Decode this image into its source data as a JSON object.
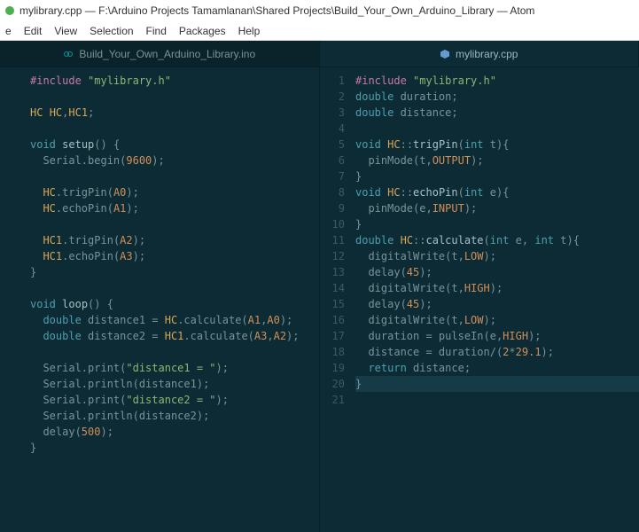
{
  "window": {
    "title": "mylibrary.cpp — F:\\Arduino Projects Tamamlanan\\Shared Projects\\Build_Your_Own_Arduino_Library — Atom"
  },
  "menu": {
    "items": [
      "e",
      "Edit",
      "View",
      "Selection",
      "Find",
      "Packages",
      "Help"
    ]
  },
  "tabs": {
    "left": {
      "label": "Build_Your_Own_Arduino_Library.ino",
      "icon": "arduino-icon",
      "active": false
    },
    "right": {
      "label": "mylibrary.cpp",
      "icon": "cpp-icon",
      "active": true
    }
  },
  "left_pane": {
    "lines": [
      {
        "tokens": [
          [
            "pre",
            "#include"
          ],
          [
            "punc",
            " "
          ],
          [
            "str",
            "\"mylibrary.h\""
          ]
        ]
      },
      {
        "tokens": []
      },
      {
        "tokens": [
          [
            "cls",
            "HC"
          ],
          [
            "punc",
            " "
          ],
          [
            "cls",
            "HC"
          ],
          [
            "punc",
            ","
          ],
          [
            "cls",
            "HC1"
          ],
          [
            "punc",
            ";"
          ]
        ]
      },
      {
        "tokens": []
      },
      {
        "tokens": [
          [
            "type",
            "void"
          ],
          [
            "punc",
            " "
          ],
          [
            "fn",
            "setup"
          ],
          [
            "punc",
            "() {"
          ]
        ]
      },
      {
        "tokens": [
          [
            "punc",
            "  Serial.begin("
          ],
          [
            "num",
            "9600"
          ],
          [
            "punc",
            ");"
          ]
        ]
      },
      {
        "tokens": []
      },
      {
        "tokens": [
          [
            "punc",
            "  "
          ],
          [
            "cls",
            "HC"
          ],
          [
            "punc",
            ".trigPin("
          ],
          [
            "const",
            "A0"
          ],
          [
            "punc",
            ");"
          ]
        ]
      },
      {
        "tokens": [
          [
            "punc",
            "  "
          ],
          [
            "cls",
            "HC"
          ],
          [
            "punc",
            ".echoPin("
          ],
          [
            "const",
            "A1"
          ],
          [
            "punc",
            ");"
          ]
        ]
      },
      {
        "tokens": []
      },
      {
        "tokens": [
          [
            "punc",
            "  "
          ],
          [
            "cls",
            "HC1"
          ],
          [
            "punc",
            ".trigPin("
          ],
          [
            "const",
            "A2"
          ],
          [
            "punc",
            ");"
          ]
        ]
      },
      {
        "tokens": [
          [
            "punc",
            "  "
          ],
          [
            "cls",
            "HC1"
          ],
          [
            "punc",
            ".echoPin("
          ],
          [
            "const",
            "A3"
          ],
          [
            "punc",
            ");"
          ]
        ]
      },
      {
        "tokens": [
          [
            "punc",
            "}"
          ]
        ]
      },
      {
        "tokens": []
      },
      {
        "tokens": [
          [
            "type",
            "void"
          ],
          [
            "punc",
            " "
          ],
          [
            "fn",
            "loop"
          ],
          [
            "punc",
            "() {"
          ]
        ]
      },
      {
        "tokens": [
          [
            "punc",
            "  "
          ],
          [
            "type",
            "double"
          ],
          [
            "punc",
            " distance1 = "
          ],
          [
            "cls",
            "HC"
          ],
          [
            "punc",
            ".calculate("
          ],
          [
            "const",
            "A1"
          ],
          [
            "punc",
            ","
          ],
          [
            "const",
            "A0"
          ],
          [
            "punc",
            ");"
          ]
        ]
      },
      {
        "tokens": [
          [
            "punc",
            "  "
          ],
          [
            "type",
            "double"
          ],
          [
            "punc",
            " distance2 = "
          ],
          [
            "cls",
            "HC1"
          ],
          [
            "punc",
            ".calculate("
          ],
          [
            "const",
            "A3"
          ],
          [
            "punc",
            ","
          ],
          [
            "const",
            "A2"
          ],
          [
            "punc",
            ");"
          ]
        ]
      },
      {
        "tokens": []
      },
      {
        "tokens": [
          [
            "punc",
            "  Serial.print("
          ],
          [
            "str",
            "\"distance1 = \""
          ],
          [
            "punc",
            ");"
          ]
        ]
      },
      {
        "tokens": [
          [
            "punc",
            "  Serial.println(distance1);"
          ]
        ]
      },
      {
        "tokens": [
          [
            "punc",
            "  Serial.print("
          ],
          [
            "str",
            "\"distance2 = \""
          ],
          [
            "punc",
            ");"
          ]
        ]
      },
      {
        "tokens": [
          [
            "punc",
            "  Serial.println(distance2);"
          ]
        ]
      },
      {
        "tokens": [
          [
            "punc",
            "  delay("
          ],
          [
            "num",
            "500"
          ],
          [
            "punc",
            ");"
          ]
        ]
      },
      {
        "tokens": [
          [
            "punc",
            "}"
          ]
        ]
      }
    ]
  },
  "right_pane": {
    "line_numbers": [
      "1",
      "2",
      "3",
      "4",
      "5",
      "6",
      "7",
      "8",
      "9",
      "10",
      "11",
      "12",
      "13",
      "14",
      "15",
      "16",
      "17",
      "18",
      "19",
      "20",
      "21"
    ],
    "highlight_line": 19,
    "lines": [
      {
        "tokens": [
          [
            "pre",
            "#include"
          ],
          [
            "punc",
            " "
          ],
          [
            "str",
            "\"mylibrary.h\""
          ]
        ]
      },
      {
        "tokens": [
          [
            "type",
            "double"
          ],
          [
            "punc",
            " duration;"
          ]
        ]
      },
      {
        "tokens": [
          [
            "type",
            "double"
          ],
          [
            "punc",
            " distance;"
          ]
        ]
      },
      {
        "tokens": []
      },
      {
        "tokens": [
          [
            "type",
            "void"
          ],
          [
            "punc",
            " "
          ],
          [
            "cls",
            "HC"
          ],
          [
            "punc",
            "::"
          ],
          [
            "fn",
            "trigPin"
          ],
          [
            "punc",
            "("
          ],
          [
            "type",
            "int"
          ],
          [
            "punc",
            " t){"
          ]
        ]
      },
      {
        "tokens": [
          [
            "punc",
            "  pinMode(t,"
          ],
          [
            "const",
            "OUTPUT"
          ],
          [
            "punc",
            ");"
          ]
        ]
      },
      {
        "tokens": [
          [
            "punc",
            "}"
          ]
        ]
      },
      {
        "tokens": [
          [
            "type",
            "void"
          ],
          [
            "punc",
            " "
          ],
          [
            "cls",
            "HC"
          ],
          [
            "punc",
            "::"
          ],
          [
            "fn",
            "echoPin"
          ],
          [
            "punc",
            "("
          ],
          [
            "type",
            "int"
          ],
          [
            "punc",
            " e){"
          ]
        ]
      },
      {
        "tokens": [
          [
            "punc",
            "  pinMode(e,"
          ],
          [
            "const",
            "INPUT"
          ],
          [
            "punc",
            ");"
          ]
        ]
      },
      {
        "tokens": [
          [
            "punc",
            "}"
          ]
        ]
      },
      {
        "tokens": [
          [
            "type",
            "double"
          ],
          [
            "punc",
            " "
          ],
          [
            "cls",
            "HC"
          ],
          [
            "punc",
            "::"
          ],
          [
            "fn",
            "calculate"
          ],
          [
            "punc",
            "("
          ],
          [
            "type",
            "int"
          ],
          [
            "punc",
            " e, "
          ],
          [
            "type",
            "int"
          ],
          [
            "punc",
            " t){"
          ]
        ]
      },
      {
        "tokens": [
          [
            "punc",
            "  digitalWrite(t,"
          ],
          [
            "const",
            "LOW"
          ],
          [
            "punc",
            ");"
          ]
        ]
      },
      {
        "tokens": [
          [
            "punc",
            "  delay("
          ],
          [
            "num",
            "45"
          ],
          [
            "punc",
            ");"
          ]
        ]
      },
      {
        "tokens": [
          [
            "punc",
            "  digitalWrite(t,"
          ],
          [
            "const",
            "HIGH"
          ],
          [
            "punc",
            ");"
          ]
        ]
      },
      {
        "tokens": [
          [
            "punc",
            "  delay("
          ],
          [
            "num",
            "45"
          ],
          [
            "punc",
            ");"
          ]
        ]
      },
      {
        "tokens": [
          [
            "punc",
            "  digitalWrite(t,"
          ],
          [
            "const",
            "LOW"
          ],
          [
            "punc",
            ");"
          ]
        ]
      },
      {
        "tokens": [
          [
            "punc",
            "  duration = pulseIn(e,"
          ],
          [
            "const",
            "HIGH"
          ],
          [
            "punc",
            ");"
          ]
        ]
      },
      {
        "tokens": [
          [
            "punc",
            "  distance = duration/("
          ],
          [
            "num",
            "2"
          ],
          [
            "punc",
            "*"
          ],
          [
            "num",
            "29.1"
          ],
          [
            "punc",
            ");"
          ]
        ]
      },
      {
        "tokens": [
          [
            "punc",
            "  "
          ],
          [
            "type",
            "return"
          ],
          [
            "punc",
            " distance;"
          ]
        ]
      },
      {
        "tokens": [
          [
            "punc",
            "}"
          ]
        ]
      },
      {
        "tokens": []
      }
    ]
  }
}
